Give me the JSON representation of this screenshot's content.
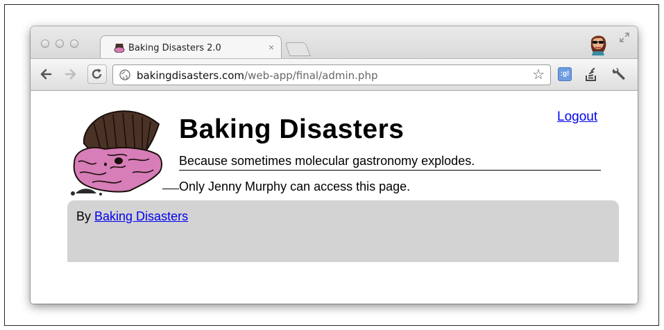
{
  "browser": {
    "tab": {
      "title": "Baking Disasters 2.0",
      "close": "×"
    },
    "address_bar": {
      "host": "bakingdisasters.com",
      "path": "/web-app/final/admin.php"
    },
    "icons": {
      "back": "arrow-left-icon",
      "forward": "arrow-right-icon",
      "reload": "reload-icon",
      "globe": "globe-icon",
      "bookmark": "star-icon",
      "extension_google": "google-extension-icon",
      "extension_stack": "stack-extension-icon",
      "settings": "wrench-icon",
      "profile": "avatar-icon",
      "fullscreen": "fullscreen-icon"
    },
    "google_ext_label": ":g!"
  },
  "page": {
    "title": "Baking Disasters",
    "tagline": "Because sometimes molecular gastronomy explodes.",
    "logout": "Logout",
    "access_message": "Only Jenny Murphy can access this page.",
    "footer": {
      "by_label": "By ",
      "link": "Baking Disasters"
    }
  },
  "colors": {
    "link": "#0000ee",
    "footer_bg": "#d3d3d3"
  }
}
